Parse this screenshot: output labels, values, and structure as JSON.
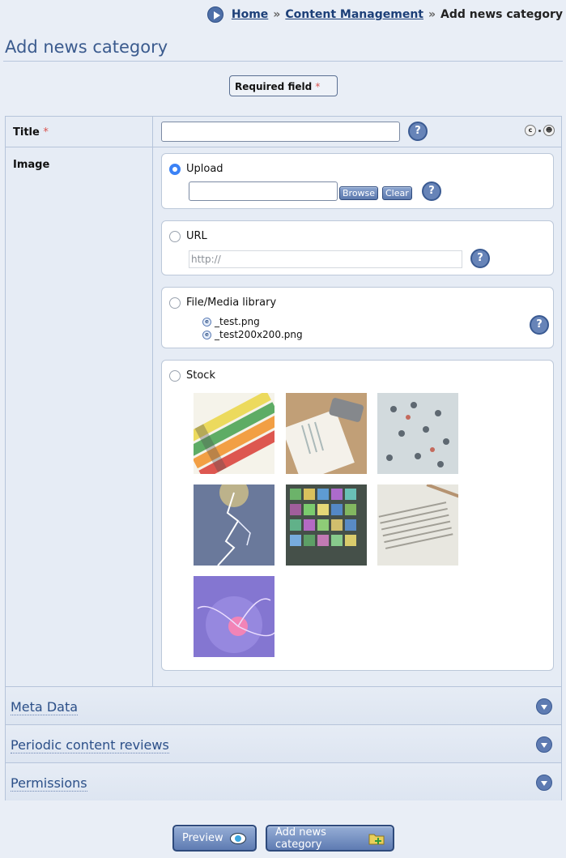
{
  "breadcrumb": {
    "home": "Home",
    "section": "Content Management",
    "current": "Add news category",
    "separator": "»"
  },
  "page": {
    "title": "Add news category"
  },
  "legend": {
    "required_label": "Required field",
    "star": "*"
  },
  "form": {
    "title_label": "Title",
    "image_label": "Image",
    "title_value": "",
    "upload": {
      "label": "Upload",
      "browse": "Browse",
      "clear": "Clear",
      "selected": true
    },
    "url": {
      "label": "URL",
      "placeholder": "http://"
    },
    "library": {
      "label": "File/Media library",
      "files": [
        "_test.png",
        "_test200x200.png"
      ]
    },
    "stock": {
      "label": "Stock",
      "images": [
        "crayons",
        "notebook-phone",
        "crowd",
        "lightning",
        "video-wall",
        "newspaper",
        "plasma-ball"
      ]
    },
    "help_glyph": "?"
  },
  "sections": {
    "meta": "Meta Data",
    "reviews": "Periodic content reviews",
    "permissions": "Permissions"
  },
  "actions": {
    "preview": "Preview",
    "add": "Add news category"
  },
  "colors": {
    "accent": "#5e7bb2",
    "link": "#1c3f78",
    "background": "#e9eef6",
    "radio_on": "#3b82f6"
  }
}
